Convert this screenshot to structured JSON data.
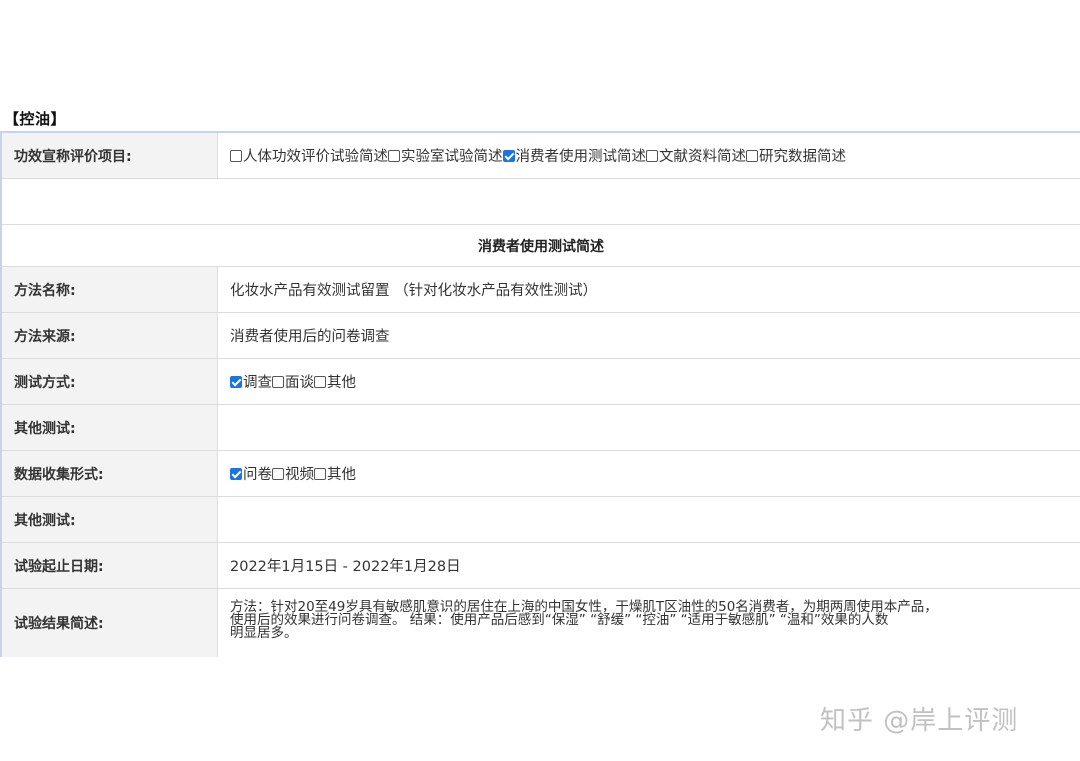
{
  "section": {
    "title": "【控油】"
  },
  "efficacy": {
    "label": "功效宣称评价项目:",
    "options": [
      {
        "label": "人体功效评价试验简述",
        "checked": false
      },
      {
        "label": "实验室试验简述",
        "checked": false
      },
      {
        "label": "消费者使用测试简述",
        "checked": true
      },
      {
        "label": "文献资料简述",
        "checked": false
      },
      {
        "label": "研究数据简述",
        "checked": false
      }
    ]
  },
  "subsection": {
    "title": "消费者使用测试简述"
  },
  "method_name": {
    "label": "方法名称:",
    "value": "化妆水产品有效测试留置 （针对化妆水产品有效性测试）"
  },
  "method_source": {
    "label": "方法来源:",
    "value": "消费者使用后的问卷调查"
  },
  "test_mode": {
    "label": "测试方式:",
    "options": [
      {
        "label": "调查",
        "checked": true
      },
      {
        "label": "面谈",
        "checked": false
      },
      {
        "label": "其他",
        "checked": false
      }
    ]
  },
  "other_test_1": {
    "label": "其他测试:",
    "value": ""
  },
  "data_collection": {
    "label": "数据收集形式:",
    "options": [
      {
        "label": "问卷",
        "checked": true
      },
      {
        "label": "视频",
        "checked": false
      },
      {
        "label": "其他",
        "checked": false
      }
    ]
  },
  "other_test_2": {
    "label": "其他测试:",
    "value": ""
  },
  "date_range": {
    "label": "试验起止日期:",
    "value": "2022年1月15日 - 2022年1月28日"
  },
  "result_summary": {
    "label": "试验结果简述:",
    "lines": [
      "方法：针对20至49岁具有敏感肌意识的居住在上海的中国女性，干燥肌T区油性的50名消费者，为期两周使用本产品，",
      "使用后的效果进行问卷调查。 结果：使用产品后感到“保湿” “舒缓” “控油” “适用于敏感肌” “温和”效果的人数",
      "明显居多。"
    ]
  },
  "watermark": "知乎 @岸上评测"
}
